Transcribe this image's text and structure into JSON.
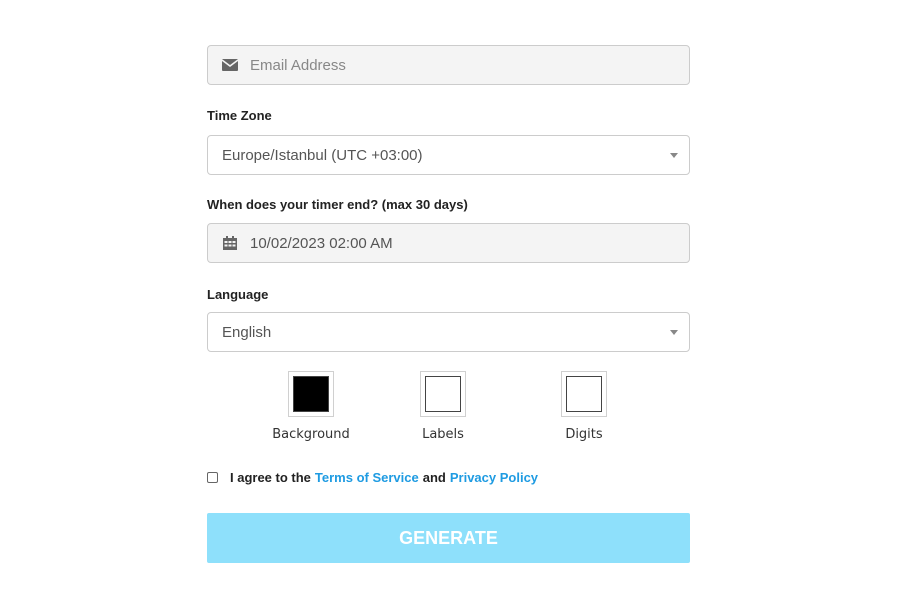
{
  "email": {
    "placeholder": "Email Address",
    "icon": "envelope-icon"
  },
  "timezone": {
    "label": "Time Zone",
    "selected": "Europe/Istanbul (UTC +03:00)"
  },
  "timer_end": {
    "label": "When does your timer end? (max 30 days)",
    "value": "10/02/2023 02:00 AM",
    "icon": "calendar-icon"
  },
  "language": {
    "label": "Language",
    "selected": "English"
  },
  "colors": [
    {
      "label": "Background",
      "color": "#000000"
    },
    {
      "label": "Labels",
      "color": "#ffffff"
    },
    {
      "label": "Digits",
      "color": "#ffffff"
    }
  ],
  "agree": {
    "prefix": "I agree to the",
    "terms_link": "Terms of Service",
    "conjunction": "and",
    "privacy_link": "Privacy Policy",
    "checked": false
  },
  "generate_label": "GENERATE",
  "theme": {
    "accent": "#1e9be2",
    "button_bg": "#8ee0fb"
  }
}
